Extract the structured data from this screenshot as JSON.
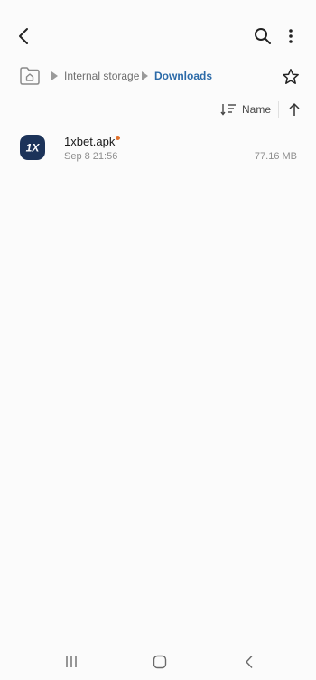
{
  "header": {
    "icons": [
      "back-arrow-icon",
      "search-icon",
      "more-vertical-icon"
    ]
  },
  "path": {
    "home_icon": "home-folder-icon",
    "segments": [
      {
        "label": "Internal storage"
      },
      {
        "label": "Downloads"
      }
    ],
    "favorite_icon": "star-outline-icon"
  },
  "sort": {
    "label": "Name",
    "direction": "ascending"
  },
  "files": [
    {
      "name": "1xbet.apk",
      "date": "Sep 8 21:56",
      "size": "77.16 MB",
      "is_new": true,
      "icon_text": "1X",
      "icon_color": "#1c3359"
    }
  ],
  "navigation": {
    "buttons": [
      "recents-icon",
      "home-icon",
      "back-icon"
    ]
  },
  "colors": {
    "accent": "#2b6aa8",
    "new_indicator": "#e0712c",
    "background": "#fbfbfb"
  }
}
